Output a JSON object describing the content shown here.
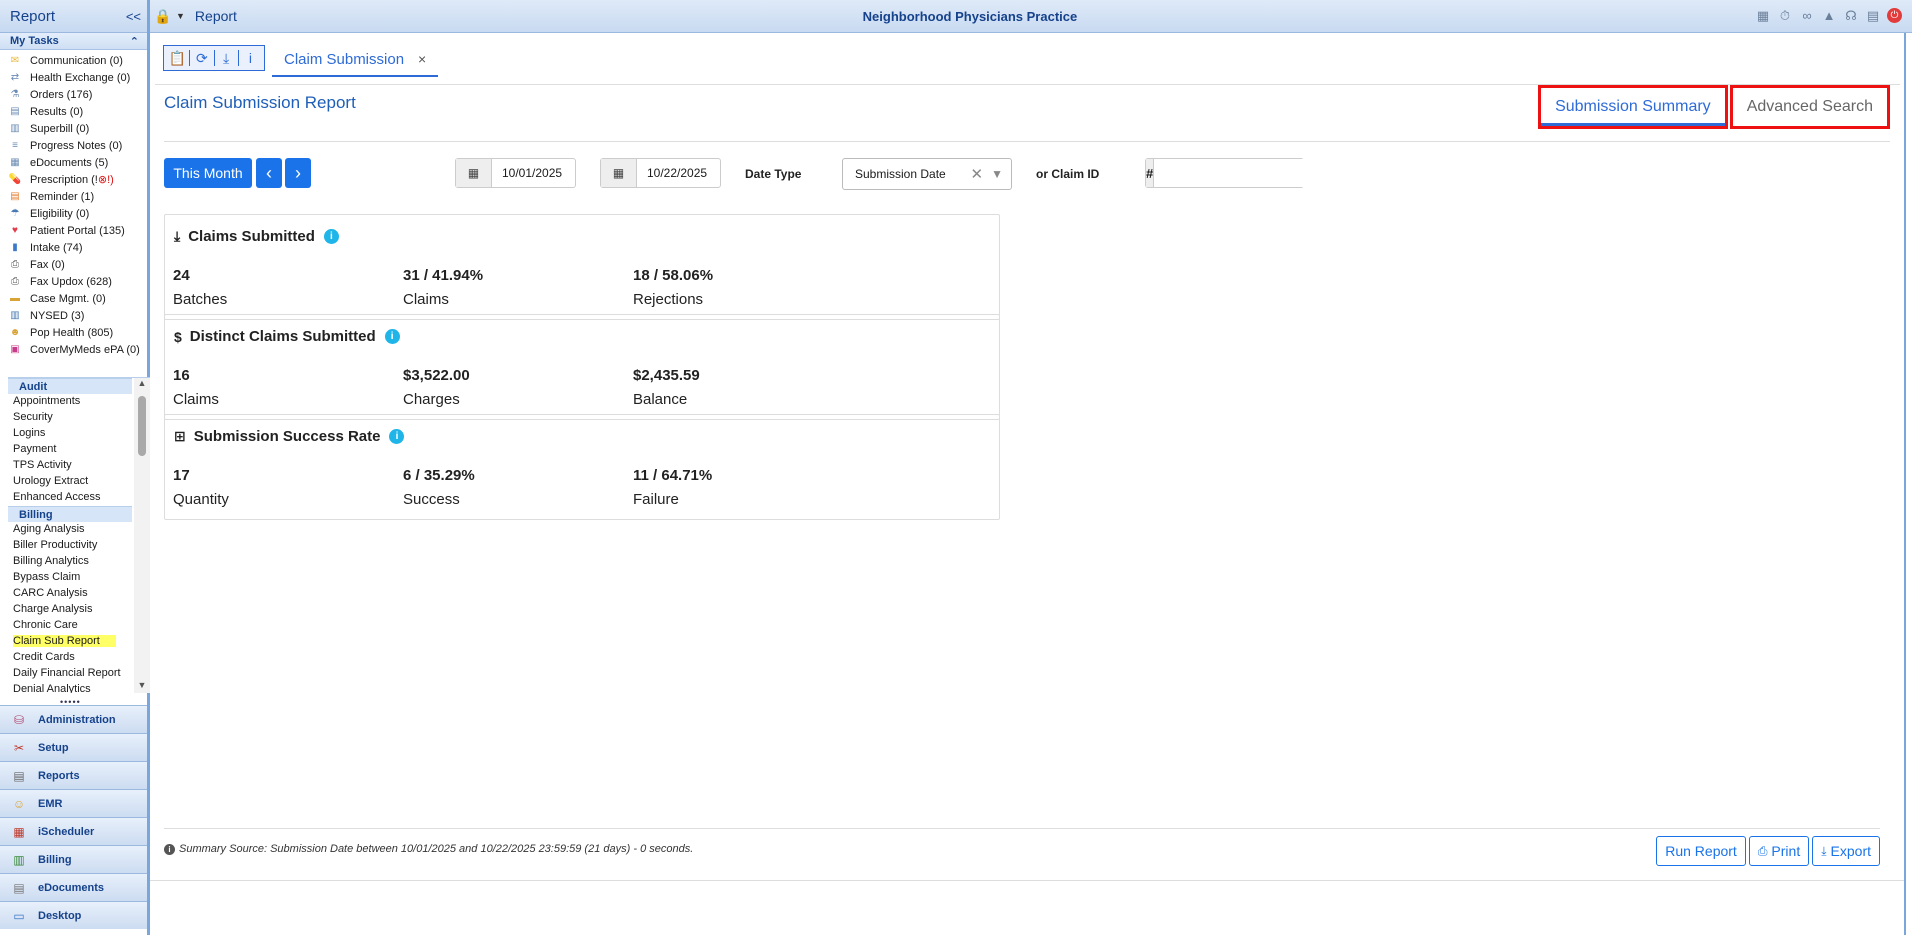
{
  "sidebar": {
    "title": "Report",
    "collapse": "<<",
    "my_tasks_label": "My Tasks",
    "tasks": [
      {
        "label": "Communication (0)",
        "icon": "envelope-icon",
        "glyph": "✉",
        "color": "#e8b93b"
      },
      {
        "label": "Health Exchange (0)",
        "icon": "exchange-icon",
        "glyph": "⇄",
        "color": "#6b8bb3"
      },
      {
        "label": "Orders (176)",
        "icon": "flask-icon",
        "glyph": "⚗",
        "color": "#6b8bb3"
      },
      {
        "label": "Results (0)",
        "icon": "document-icon",
        "glyph": "▤",
        "color": "#6b8bb3"
      },
      {
        "label": "Superbill (0)",
        "icon": "superbill-icon",
        "glyph": "▥",
        "color": "#6b8bb3"
      },
      {
        "label": "Progress Notes (0)",
        "icon": "notes-icon",
        "glyph": "≡",
        "color": "#6b8bb3"
      },
      {
        "label": "eDocuments (5)",
        "icon": "edocuments-icon",
        "glyph": "▦",
        "color": "#6b8bb3"
      },
      {
        "label": "Prescription (!",
        "label_suffix": "!)",
        "icon": "pill-icon",
        "glyph": "💊",
        "color": "#d33"
      },
      {
        "label": "Reminder (1)",
        "icon": "reminder-icon",
        "glyph": "▤",
        "color": "#e37b2b"
      },
      {
        "label": "Eligibility (0)",
        "icon": "umbrella-icon",
        "glyph": "☂",
        "color": "#4a7ab5"
      },
      {
        "label": "Patient Portal (135)",
        "icon": "heart-icon",
        "glyph": "♥",
        "color": "#e23b4b"
      },
      {
        "label": "Intake (74)",
        "icon": "intake-icon",
        "glyph": "▮",
        "color": "#3a78c8"
      },
      {
        "label": "Fax (0)",
        "icon": "fax-icon",
        "glyph": "⎙",
        "color": "#555"
      },
      {
        "label": "Fax Updox (628)",
        "icon": "fax-updox-icon",
        "glyph": "⎙",
        "color": "#555"
      },
      {
        "label": "Case Mgmt. (0)",
        "icon": "briefcase-icon",
        "glyph": "▬",
        "color": "#d9a436"
      },
      {
        "label": "NYSED (3)",
        "icon": "chart-icon",
        "glyph": "▥",
        "color": "#4a7ab5"
      },
      {
        "label": "Pop Health (805)",
        "icon": "people-icon",
        "glyph": "☻",
        "color": "#d9a436"
      },
      {
        "label": "CoverMyMeds ePA (0)",
        "icon": "covermymeds-icon",
        "glyph": "▣",
        "color": "#c83a8a"
      }
    ],
    "audit_label": "Audit",
    "audit_items": [
      "Appointments",
      "Security",
      "Logins",
      "Payment",
      "TPS Activity",
      "Urology Extract",
      "Enhanced Access"
    ],
    "billing_label": "Billing",
    "billing_items": [
      "Aging Analysis",
      "Biller Productivity",
      "Billing Analytics",
      "Bypass Claim",
      "CARC Analysis",
      "Charge Analysis",
      "Chronic Care",
      "Claim Sub Report",
      "Credit Cards",
      "Daily Financial Report",
      "Denial Analytics"
    ],
    "active_report": "Claim Sub Report",
    "modules": [
      {
        "label": "Administration",
        "icon": "database-icon",
        "glyph": "⛁",
        "color": "#b3476d"
      },
      {
        "label": "Setup",
        "icon": "tools-icon",
        "glyph": "✂",
        "color": "#c0392b"
      },
      {
        "label": "Reports",
        "icon": "clipboard-icon",
        "glyph": "▤",
        "color": "#6b6b6b"
      },
      {
        "label": "EMR",
        "icon": "doctor-icon",
        "glyph": "☺",
        "color": "#d9a436"
      },
      {
        "label": "iScheduler",
        "icon": "calendar-icon",
        "glyph": "▦",
        "color": "#c0392b"
      },
      {
        "label": "Billing",
        "icon": "billing-icon",
        "glyph": "▥",
        "color": "#3a8a3a"
      },
      {
        "label": "eDocuments",
        "icon": "cabinet-icon",
        "glyph": "▤",
        "color": "#777"
      },
      {
        "label": "Desktop",
        "icon": "desktop-icon",
        "glyph": "▭",
        "color": "#3a78c8"
      }
    ]
  },
  "topbar": {
    "title": "Report",
    "practice": "Neighborhood Physicians Practice",
    "icons": [
      "map-icon",
      "stopwatch-icon",
      "binoculars-icon",
      "graduation-cap-icon",
      "headset-icon",
      "grid-icon",
      "power-icon"
    ]
  },
  "tab": {
    "label": "Claim Submission",
    "close": "×"
  },
  "toolbox_icons": [
    "clipboard-icon",
    "refresh-icon",
    "download-icon",
    "info-icon"
  ],
  "main": {
    "page_title": "Claim Submission Report",
    "subtabs": {
      "summary": "Submission Summary",
      "advanced": "Advanced Search"
    },
    "filters": {
      "this_month": "This Month",
      "prev": "‹",
      "next": "›",
      "from_date": "10/01/2025",
      "to_date": "10/22/2025",
      "date_type_label": "Date Type",
      "date_type_value": "Submission Date",
      "claim_id_label": "or Claim ID",
      "claim_id_prefix": "#",
      "claim_id_value": ""
    },
    "cards": [
      {
        "title": "Claims Submitted",
        "icon": "file-download-icon",
        "metrics": [
          {
            "value": "24",
            "caption": "Batches"
          },
          {
            "value": "31 / 41.94%",
            "caption": "Claims"
          },
          {
            "value": "18 / 58.06%",
            "caption": "Rejections"
          }
        ]
      },
      {
        "title": "Distinct Claims Submitted",
        "icon": "dollar-icon",
        "metrics": [
          {
            "value": "16",
            "caption": "Claims"
          },
          {
            "value": "$3,522.00",
            "caption": "Charges"
          },
          {
            "value": "$2,435.59",
            "caption": "Balance"
          }
        ]
      },
      {
        "title": "Submission Success Rate",
        "icon": "folder-plus-icon",
        "metrics": [
          {
            "value": "17",
            "caption": "Quantity"
          },
          {
            "value": "6 / 35.29%",
            "caption": "Success"
          },
          {
            "value": "11 / 64.71%",
            "caption": "Failure"
          }
        ]
      }
    ],
    "footnote": "Summary Source: Submission Date between 10/01/2025 and 10/22/2025 23:59:59 (21 days) - 0 seconds.",
    "buttons": {
      "run": "Run Report",
      "print": "Print",
      "export": "Export"
    }
  }
}
